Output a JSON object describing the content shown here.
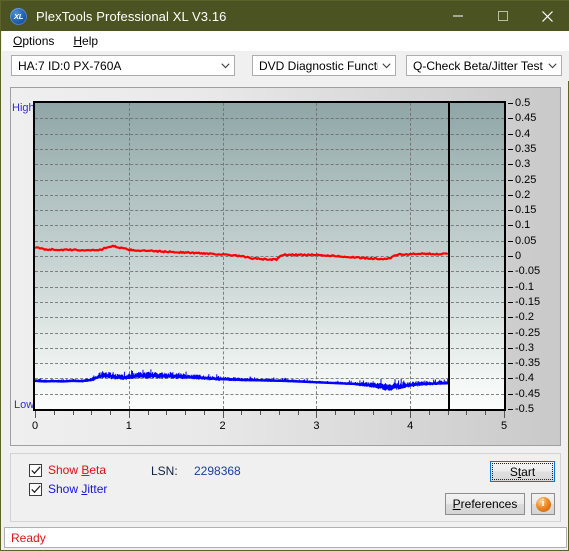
{
  "window": {
    "title": "PlexTools Professional XL V3.16",
    "icon": "xl-app-icon",
    "icon_text": "XL",
    "minimize_label": "–",
    "maximize_label": "□",
    "close_label": "✕",
    "titlebar_color": "#4c5322"
  },
  "menu": {
    "items": [
      {
        "label": "Options",
        "accel": "O"
      },
      {
        "label": "Help",
        "accel": "H"
      }
    ]
  },
  "toolbar": {
    "drive_select": {
      "value": "HA:7 ID:0  PX-760A"
    },
    "function_select": {
      "value": "DVD Diagnostic Functions"
    },
    "test_select": {
      "value": "Q-Check Beta/Jitter Test"
    }
  },
  "chart_data": {
    "type": "line",
    "title": "",
    "xlabel": "",
    "ylabel": "",
    "xlim": [
      0,
      5
    ],
    "ylim": [
      -0.5,
      0.5
    ],
    "xticks": [
      0,
      1,
      2,
      3,
      4,
      5
    ],
    "xtick_labels": [
      "0",
      "1",
      "2",
      "3",
      "4",
      "5"
    ],
    "yticks": [
      0.5,
      0.45,
      0.4,
      0.35,
      0.3,
      0.25,
      0.2,
      0.15,
      0.1,
      0.05,
      0,
      -0.05,
      -0.1,
      -0.15,
      -0.2,
      -0.25,
      -0.3,
      -0.35,
      -0.4,
      -0.45,
      -0.5
    ],
    "ytick_labels": [
      "0.5",
      "0.45",
      "0.4",
      "0.35",
      "0.3",
      "0.25",
      "0.2",
      "0.15",
      "0.1",
      "0.05",
      "0",
      "-0.05",
      "-0.1",
      "-0.15",
      "-0.2",
      "-0.25",
      "-0.3",
      "-0.35",
      "-0.4",
      "-0.45",
      "-0.5"
    ],
    "grid": true,
    "grid_style": "dashed",
    "grid_color": "#6e6e6e",
    "vertical_gridlines_at": [
      1,
      2,
      3,
      4
    ],
    "axis_high_label": "High",
    "axis_low_label": "Low",
    "cursor_marker_x": 4.4,
    "data_end_x": 4.4,
    "series": [
      {
        "name": "Beta",
        "color": "#ff0000",
        "visible": true,
        "x": [
          0.0,
          0.1,
          0.2,
          0.3,
          0.4,
          0.5,
          0.6,
          0.7,
          0.78,
          0.85,
          0.92,
          1.0,
          1.1,
          1.25,
          1.4,
          1.55,
          1.7,
          1.85,
          2.0,
          2.1,
          2.2,
          2.25,
          2.32,
          2.4,
          2.5,
          2.58,
          2.62,
          2.7,
          2.85,
          3.0,
          3.15,
          3.3,
          3.45,
          3.6,
          3.7,
          3.78,
          3.85,
          4.0,
          4.15,
          4.3,
          4.4
        ],
        "y": [
          0.028,
          0.022,
          0.021,
          0.02,
          0.02,
          0.019,
          0.019,
          0.02,
          0.03,
          0.032,
          0.026,
          0.02,
          0.018,
          0.016,
          0.014,
          0.012,
          0.01,
          0.008,
          0.005,
          0.002,
          -0.001,
          -0.004,
          -0.008,
          -0.01,
          -0.011,
          -0.012,
          0.003,
          0.004,
          0.004,
          0.003,
          0.001,
          -0.002,
          -0.006,
          -0.008,
          -0.009,
          -0.009,
          0.004,
          0.006,
          0.007,
          0.007,
          0.006
        ]
      },
      {
        "name": "Jitter",
        "color": "#0000ff",
        "visible": true,
        "x": [
          0.0,
          0.1,
          0.2,
          0.3,
          0.4,
          0.5,
          0.6,
          0.68,
          0.75,
          0.85,
          0.95,
          1.05,
          1.15,
          1.25,
          1.35,
          1.45,
          1.55,
          1.65,
          1.75,
          1.85,
          1.95,
          2.05,
          2.2,
          2.35,
          2.5,
          2.65,
          2.8,
          2.95,
          3.1,
          3.25,
          3.4,
          3.55,
          3.65,
          3.75,
          3.85,
          3.95,
          4.05,
          4.15,
          4.25,
          4.35,
          4.4
        ],
        "y_center": [
          -0.408,
          -0.41,
          -0.409,
          -0.41,
          -0.408,
          -0.409,
          -0.405,
          -0.395,
          -0.39,
          -0.396,
          -0.398,
          -0.393,
          -0.392,
          -0.391,
          -0.393,
          -0.392,
          -0.394,
          -0.396,
          -0.398,
          -0.4,
          -0.402,
          -0.403,
          -0.405,
          -0.406,
          -0.407,
          -0.408,
          -0.41,
          -0.412,
          -0.414,
          -0.416,
          -0.418,
          -0.422,
          -0.426,
          -0.43,
          -0.428,
          -0.424,
          -0.42,
          -0.418,
          -0.417,
          -0.416,
          -0.416
        ],
        "noise_amplitude": [
          0.008,
          0.009,
          0.009,
          0.01,
          0.009,
          0.01,
          0.012,
          0.018,
          0.022,
          0.018,
          0.017,
          0.019,
          0.02,
          0.02,
          0.019,
          0.02,
          0.018,
          0.016,
          0.015,
          0.014,
          0.013,
          0.012,
          0.011,
          0.01,
          0.01,
          0.009,
          0.008,
          0.008,
          0.007,
          0.008,
          0.01,
          0.015,
          0.02,
          0.024,
          0.022,
          0.019,
          0.016,
          0.014,
          0.013,
          0.012,
          0.012
        ]
      }
    ]
  },
  "controls": {
    "show_beta": {
      "label_pre": "Show ",
      "label_accel": "B",
      "label_post": "eta",
      "checked": true,
      "color": "#e01010"
    },
    "show_jitter": {
      "label_pre": "Show ",
      "label_accel": "J",
      "label_post": "itter",
      "checked": true,
      "color": "#1414dc"
    },
    "lsn_label": "LSN:",
    "lsn_value": "2298368",
    "start_button": {
      "pre": "S",
      "accel": "t",
      "post": "art",
      "focused": true
    },
    "preferences_button": {
      "pre": "",
      "accel": "P",
      "post": "references"
    },
    "info_button": {
      "glyph": "i",
      "name": "info-icon"
    }
  },
  "statusbar": {
    "text": "Ready",
    "color": "#e81010"
  }
}
